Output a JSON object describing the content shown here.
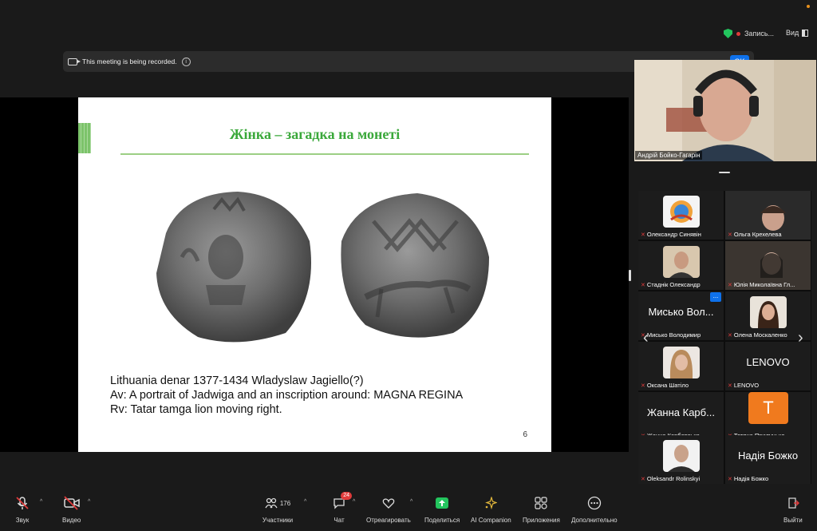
{
  "top": {
    "recording_label": "Запись...",
    "view_label": "Вид"
  },
  "banner": {
    "text": "This meeting is being recorded.",
    "ok": "OK"
  },
  "slide": {
    "title": "Жінка – загадка на монеті",
    "caption": [
      "Lithuania denar 1377-1434 Wladyslaw Jagiello(?)",
      "Av: A portrait of Jadwiga and an inscription around: MAGNA REGINA",
      "Rv: Tatar tamga lion moving right."
    ],
    "page": "6"
  },
  "speaker": {
    "name": "Андрій Бойко-Гагарін"
  },
  "participants": [
    {
      "name": "Олександр Синявін",
      "display": "",
      "muted": true
    },
    {
      "name": "Ольга Крехелева",
      "display": "",
      "muted": true
    },
    {
      "name": "Стаднік Олександр",
      "display": "",
      "muted": true
    },
    {
      "name": "Юлія Миколаївна Гл...",
      "display": "",
      "muted": true
    },
    {
      "name": "Мисько Володимир",
      "display": "Мисько Вол...",
      "muted": true
    },
    {
      "name": "Олена Москаленко",
      "display": "",
      "muted": true
    },
    {
      "name": "Оксана Шатіло",
      "display": "",
      "muted": true
    },
    {
      "name": "LENOVO",
      "display": "LENOVO",
      "muted": true
    },
    {
      "name": "Жанна Карбовська",
      "display": "Жанна Карб...",
      "muted": true
    },
    {
      "name": "Тетяна Прилуцька",
      "display": "T",
      "muted": true
    },
    {
      "name": "Oleksandr Rolinskyi",
      "display": "",
      "muted": true
    },
    {
      "name": "Надія Божко",
      "display": "Надія Божко",
      "muted": true
    }
  ],
  "more_icon": "...",
  "toolbar": {
    "audio": "Звук",
    "video": "Видео",
    "participants": "Участники",
    "participants_count": "176",
    "chat": "Чат",
    "chat_badge": "24",
    "react": "Отреагировать",
    "share": "Поделиться",
    "ai": "AI Companion",
    "apps": "Приложения",
    "more": "Дополнительно",
    "leave": "Выйти"
  },
  "colors": {
    "accent": "#0e71eb",
    "share_green": "#23c55e",
    "mute_red": "#e03b3b",
    "slide_title": "#3aa83a"
  }
}
